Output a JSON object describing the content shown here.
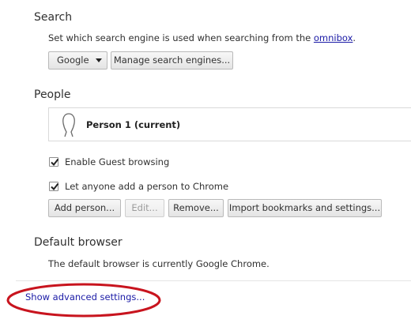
{
  "search": {
    "heading": "Search",
    "description_prefix": "Set which search engine is used when searching from the ",
    "description_link": "omnibox",
    "description_suffix": ".",
    "engine_dropdown_value": "Google",
    "manage_button": "Manage search engines..."
  },
  "people": {
    "heading": "People",
    "profile_name": "Person 1 (current)",
    "checkboxes": [
      {
        "label": "Enable Guest browsing",
        "checked": true
      },
      {
        "label": "Let anyone add a person to Chrome",
        "checked": true
      }
    ],
    "buttons": {
      "add": "Add person...",
      "edit": "Edit...",
      "remove": "Remove...",
      "import": "Import bookmarks and settings..."
    }
  },
  "default_browser": {
    "heading": "Default browser",
    "status": "The default browser is currently Google Chrome."
  },
  "advanced_link": "Show advanced settings...",
  "colors": {
    "link": "#1a1aa6",
    "highlight_ellipse": "#c8141e"
  }
}
